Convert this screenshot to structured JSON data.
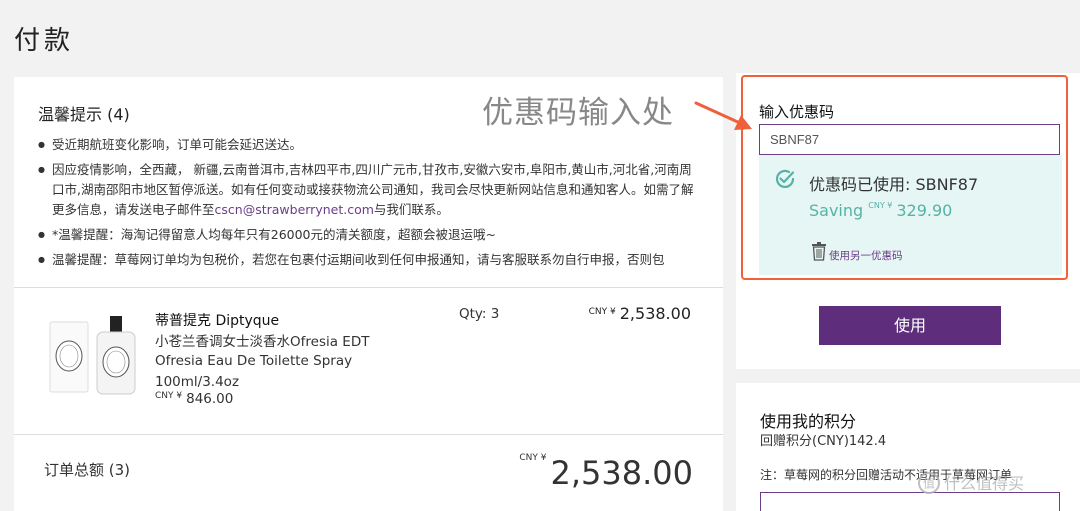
{
  "page_title": "付款",
  "annotation": {
    "label": "优惠码输入处",
    "color": "#f0603a"
  },
  "notice": {
    "title": "温馨提示 (4)",
    "items": [
      "受近期航班变化影响，订单可能会延迟送达。",
      "因应疫情影响，全西藏， 新疆,云南普洱市,吉林四平市,四川广元市,甘孜市,安徽六安市,阜阳市,黄山市,河北省,河南周口市,湖南邵阳市地区暂停派送。如有任何变动或接获物流公司通知，我司会尽快更新网站信息和通知客人。如需了解更多信息，请发送电子邮件至",
      "与我们联系。",
      "*温馨提醒：海淘记得留意人均每年只有26000元的清关额度，超额会被退运哦~",
      "温馨提醒：草莓网订单均为包税价，若您在包裹付运期间收到任何申报通知，请与客服联系勿自行申报，否则包"
    ],
    "email": "cscn@strawberrynet.com"
  },
  "product": {
    "brand": "蒂普提克 Diptyque",
    "name": "小苍兰香调女士淡香水Ofresia EDT Ofresia Eau De Toilette Spray",
    "size": "100ml/3.4oz",
    "currency": "CNY ¥",
    "unit_price": "846.00",
    "qty": "Qty: 3",
    "line_total": "2,538.00"
  },
  "total": {
    "label": "订单总额 (3)",
    "currency": "CNY ¥",
    "amount": "2,538.00"
  },
  "coupon": {
    "title": "输入优惠码",
    "input_value": "SBNF87",
    "applied_text": "优惠码已使用: SBNF87",
    "saving_label": "Saving",
    "saving_currency": "CNY ¥",
    "saving_amount": "329.90",
    "use_another": "使用另一优惠码",
    "apply_button": "使用"
  },
  "points": {
    "title": "使用我的积分",
    "value": "回赠积分(CNY)142.4",
    "note": "注：草莓网的积分回赠活动不适用于草莓网订单"
  },
  "watermark": "什么值得买",
  "colors": {
    "accent": "#5e2d7c",
    "link": "#6b3d87",
    "saving": "#57b2a6",
    "applied_bg": "#e6f6f5",
    "highlight": "#f0603a"
  }
}
